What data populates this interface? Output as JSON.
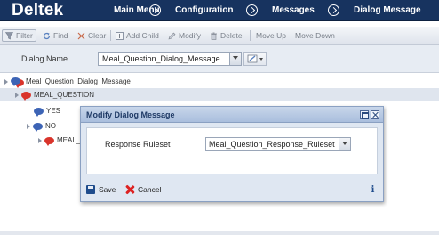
{
  "app": {
    "logo": "Deltek"
  },
  "nav": {
    "items": [
      {
        "label": "Main Menu"
      },
      {
        "label": "Configuration"
      },
      {
        "label": "Messages"
      },
      {
        "label": "Dialog Message"
      }
    ]
  },
  "toolbar": {
    "filter": "Filter",
    "find": "Find",
    "clear": "Clear",
    "add_child": "Add Child",
    "modify": "Modify",
    "delete": "Delete",
    "move_up": "Move Up",
    "move_down": "Move Down"
  },
  "dialog_name": {
    "label": "Dialog Name",
    "value": "Meal_Question_Dialog_Message"
  },
  "tree": {
    "root": "Meal_Question_Dialog_Message",
    "question": "MEAL_QUESTION",
    "yes": "YES",
    "no": "NO",
    "child": "MEAL_"
  },
  "modal": {
    "title": "Modify Dialog Message",
    "field_label": "Response Ruleset",
    "field_value": "Meal_Question_Response_Ruleset",
    "save": "Save",
    "cancel": "Cancel",
    "info_glyph": "i"
  },
  "colors": {
    "nav_bg": "#17335f",
    "modal_title": "#1f3a66",
    "bubble_blue": "#3d64b5",
    "bubble_red": "#d9342b"
  }
}
